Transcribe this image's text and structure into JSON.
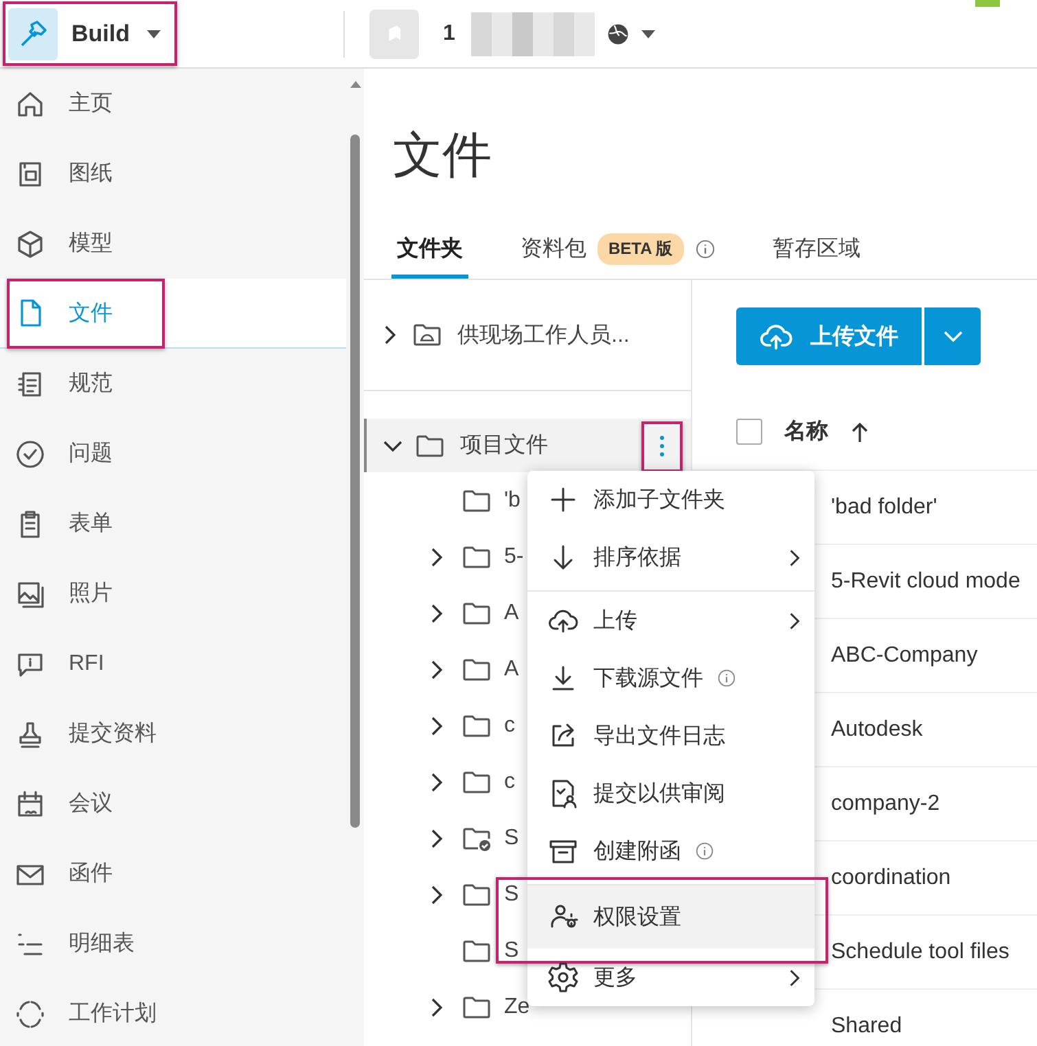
{
  "app_switcher": {
    "label": "Build",
    "highlighted": true
  },
  "project": {
    "number": "1"
  },
  "sidebar": {
    "items": [
      {
        "label": "主页",
        "kind": "home",
        "selected": false,
        "highlighted": false
      },
      {
        "label": "图纸",
        "kind": "sheets",
        "selected": false,
        "highlighted": false
      },
      {
        "label": "模型",
        "kind": "model",
        "selected": false,
        "highlighted": false
      },
      {
        "label": "文件",
        "kind": "file",
        "selected": true,
        "highlighted": true
      },
      {
        "label": "规范",
        "kind": "specs",
        "selected": false,
        "highlighted": false
      },
      {
        "label": "问题",
        "kind": "issue",
        "selected": false,
        "highlighted": false
      },
      {
        "label": "表单",
        "kind": "forms",
        "selected": false,
        "highlighted": false
      },
      {
        "label": "照片",
        "kind": "photo",
        "selected": false,
        "highlighted": false
      },
      {
        "label": "RFI",
        "kind": "rfi",
        "selected": false,
        "highlighted": false
      },
      {
        "label": "提交资料",
        "kind": "stamp",
        "selected": false,
        "highlighted": false
      },
      {
        "label": "会议",
        "kind": "meeting",
        "selected": false,
        "highlighted": false
      },
      {
        "label": "函件",
        "kind": "mail",
        "selected": false,
        "highlighted": false
      },
      {
        "label": "明细表",
        "kind": "schedule",
        "selected": false,
        "highlighted": false
      },
      {
        "label": "工作计划",
        "kind": "plan",
        "selected": false,
        "highlighted": false
      }
    ]
  },
  "page_title": "文件",
  "tabs": [
    {
      "label": "文件夹",
      "selected": true
    },
    {
      "label": "资料包",
      "badge": "BETA 版",
      "info": true,
      "selected": false
    },
    {
      "label": "暂存区域",
      "selected": false
    }
  ],
  "folder_tree": {
    "shared": {
      "label": "供现场工作人员...",
      "expanded": false
    },
    "root": {
      "label": "项目文件",
      "expanded": true,
      "selected": true,
      "more_highlighted": true,
      "children": [
        {
          "label": "'b",
          "expandable": false,
          "kind": "folder"
        },
        {
          "label": "5-",
          "expandable": true,
          "kind": "folder"
        },
        {
          "label": "A",
          "expandable": true,
          "kind": "folder"
        },
        {
          "label": "A",
          "expandable": true,
          "kind": "folder"
        },
        {
          "label": "c",
          "expandable": true,
          "kind": "folder"
        },
        {
          "label": "c",
          "expandable": true,
          "kind": "folder"
        },
        {
          "label": "S",
          "expandable": true,
          "kind": "shared_folder"
        },
        {
          "label": "S",
          "expandable": true,
          "kind": "folder"
        },
        {
          "label": "S",
          "expandable": false,
          "kind": "folder"
        },
        {
          "label": "Ze",
          "expandable": true,
          "kind": "folder"
        }
      ]
    }
  },
  "upload_button": {
    "label": "上传文件"
  },
  "table": {
    "column": "名称",
    "select_all": {
      "checked": false
    },
    "rows": [
      {
        "name": "'bad folder'"
      },
      {
        "name": "5-Revit cloud mode"
      },
      {
        "name": "ABC-Company"
      },
      {
        "name": "Autodesk"
      },
      {
        "name": "company-2"
      },
      {
        "name": "coordination"
      },
      {
        "name": "Schedule tool files"
      },
      {
        "name": "Shared"
      }
    ]
  },
  "context_menu": {
    "items": [
      {
        "label": "添加子文件夹",
        "kind": "plus",
        "submenu": false,
        "info": false,
        "divider_before": false,
        "highlighted": false
      },
      {
        "label": "排序依据",
        "kind": "sort",
        "submenu": true,
        "info": false,
        "divider_before": false,
        "highlighted": false
      },
      {
        "label": "上传",
        "kind": "upload",
        "submenu": true,
        "info": false,
        "divider_before": true,
        "highlighted": false
      },
      {
        "label": "下载源文件",
        "kind": "download",
        "submenu": false,
        "info": true,
        "divider_before": false,
        "highlighted": false
      },
      {
        "label": "导出文件日志",
        "kind": "export",
        "submenu": false,
        "info": false,
        "divider_before": false,
        "highlighted": false
      },
      {
        "label": "提交以供审阅",
        "kind": "review",
        "submenu": false,
        "info": false,
        "divider_before": false,
        "highlighted": false
      },
      {
        "label": "创建附函",
        "kind": "archive",
        "submenu": false,
        "info": true,
        "divider_before": false,
        "highlighted": false
      },
      {
        "label": "权限设置",
        "kind": "permissions",
        "submenu": false,
        "info": false,
        "divider_before": true,
        "highlighted": true
      },
      {
        "label": "更多",
        "kind": "more",
        "submenu": true,
        "info": false,
        "divider_before": false,
        "highlighted": false
      }
    ]
  }
}
